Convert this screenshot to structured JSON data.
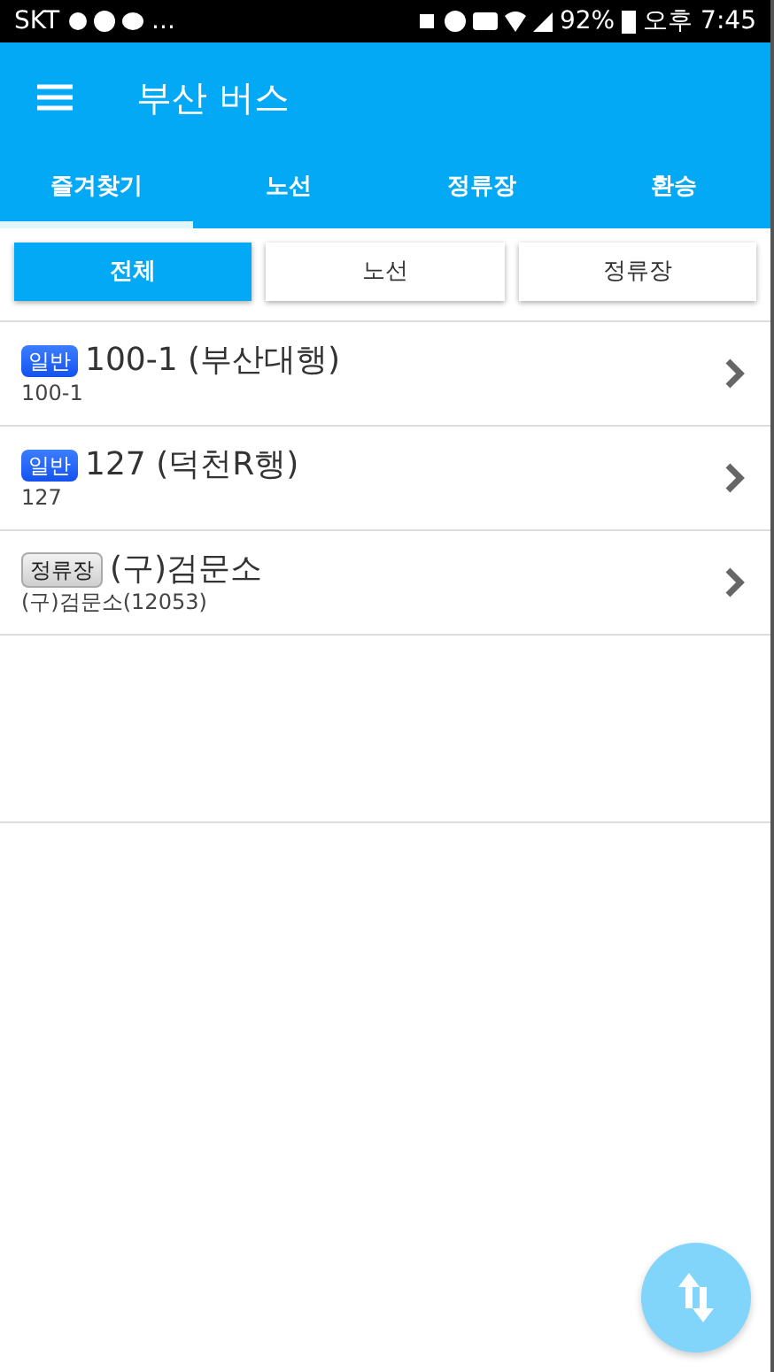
{
  "status_bar": {
    "carrier": "SKT",
    "overflow": "...",
    "battery_text": "92%",
    "time": "오후 7:45"
  },
  "app_bar": {
    "title": "부산 버스"
  },
  "tabs": [
    {
      "label": "즐겨찾기",
      "selected": true
    },
    {
      "label": "노선",
      "selected": false
    },
    {
      "label": "정류장",
      "selected": false
    },
    {
      "label": "환승",
      "selected": false
    }
  ],
  "filters": [
    {
      "label": "전체",
      "selected": true
    },
    {
      "label": "노선",
      "selected": false
    },
    {
      "label": "정류장",
      "selected": false
    }
  ],
  "favorites": [
    {
      "kind": "route",
      "badge": "일반",
      "title": "100-1 (부산대행)",
      "subtitle": "100-1"
    },
    {
      "kind": "route",
      "badge": "일반",
      "title": "127 (덕천R행)",
      "subtitle": "127"
    },
    {
      "kind": "stop",
      "badge": "정류장",
      "title": "(구)검문소",
      "subtitle": "(구)검문소(12053)"
    }
  ]
}
